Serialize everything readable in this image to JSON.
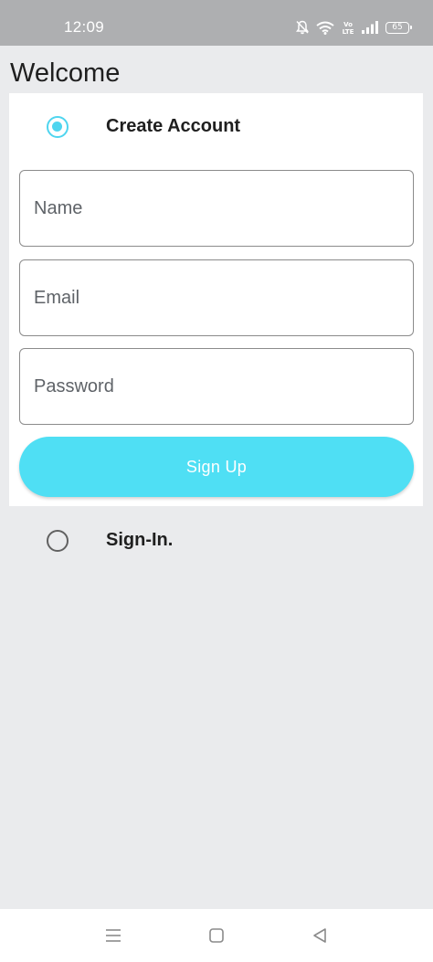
{
  "status_bar": {
    "time": "12:09",
    "volte_label": "Vo LTE",
    "battery_level": "65"
  },
  "page": {
    "title": "Welcome"
  },
  "create_account": {
    "label": "Create Account",
    "selected": true,
    "fields": {
      "name_placeholder": "Name",
      "email_placeholder": "Email",
      "password_placeholder": "Password"
    },
    "submit_label": "Sign Up"
  },
  "sign_in": {
    "label": "Sign-In.",
    "selected": false
  },
  "nav_bar": {
    "icons": [
      "menu-icon",
      "home-square-icon",
      "back-triangle-icon"
    ]
  },
  "colors": {
    "accent": "#4fd5ef",
    "button": "#4fdff4",
    "background": "#eaebed",
    "status_bar": "#aeafb1"
  }
}
